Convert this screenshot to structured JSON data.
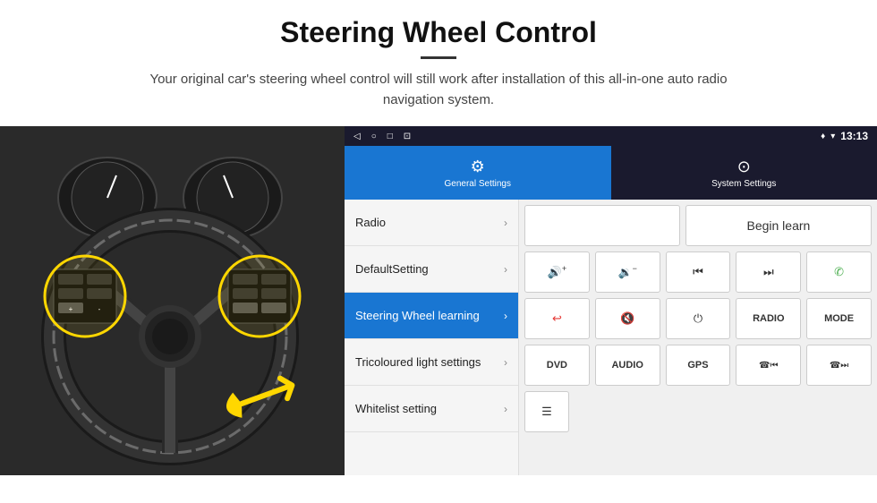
{
  "header": {
    "title": "Steering Wheel Control",
    "subtitle": "Your original car's steering wheel control will still work after installation of this all-in-one auto radio navigation system."
  },
  "status_bar": {
    "time": "13:13",
    "icons": [
      "◁",
      "○",
      "□",
      "⊡"
    ],
    "right_icons": [
      "♦",
      "▾",
      "📶"
    ]
  },
  "tabs": [
    {
      "id": "general",
      "icon": "⚙",
      "label": "General Settings",
      "active": true
    },
    {
      "id": "system",
      "icon": "⊙",
      "label": "System Settings",
      "active": false
    }
  ],
  "menu_items": [
    {
      "id": "radio",
      "label": "Radio",
      "active": false
    },
    {
      "id": "default",
      "label": "DefaultSetting",
      "active": false
    },
    {
      "id": "steering",
      "label": "Steering Wheel learning",
      "active": true
    },
    {
      "id": "tricoloured",
      "label": "Tricoloured light settings",
      "active": false
    },
    {
      "id": "whitelist",
      "label": "Whitelist setting",
      "active": false
    }
  ],
  "control_panel": {
    "begin_learn_label": "Begin learn",
    "row1": [
      {
        "id": "vol-up",
        "label": "🔊+",
        "type": "icon"
      },
      {
        "id": "vol-down",
        "label": "🔉−",
        "type": "icon"
      },
      {
        "id": "prev",
        "label": "⏮",
        "type": "icon"
      },
      {
        "id": "next",
        "label": "⏭",
        "type": "icon"
      },
      {
        "id": "phone",
        "label": "✆",
        "type": "icon"
      }
    ],
    "row2": [
      {
        "id": "hangup",
        "label": "↩",
        "type": "icon"
      },
      {
        "id": "mute-x",
        "label": "🔇",
        "type": "icon"
      },
      {
        "id": "power",
        "label": "⏻",
        "type": "icon"
      },
      {
        "id": "radio-btn",
        "label": "RADIO",
        "type": "text"
      },
      {
        "id": "mode-btn",
        "label": "MODE",
        "type": "text"
      }
    ],
    "row3": [
      {
        "id": "dvd-btn",
        "label": "DVD",
        "type": "text"
      },
      {
        "id": "audio-btn",
        "label": "AUDIO",
        "type": "text"
      },
      {
        "id": "gps-btn",
        "label": "GPS",
        "type": "text"
      },
      {
        "id": "tel-prev",
        "label": "☎⏮",
        "type": "icon"
      },
      {
        "id": "tel-next",
        "label": "☎⏭",
        "type": "icon"
      }
    ],
    "row4_single": {
      "id": "list-btn",
      "label": "☰",
      "type": "icon"
    }
  }
}
